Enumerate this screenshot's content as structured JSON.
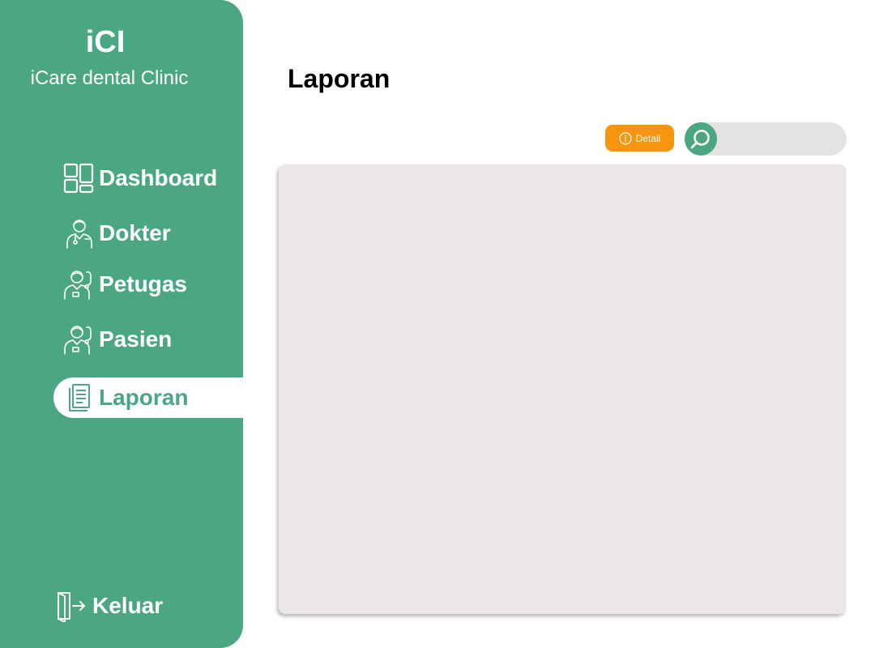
{
  "brand": {
    "logo": "iCI",
    "name": "iCare dental Clinic"
  },
  "sidebar": {
    "items": [
      {
        "label": "Dashboard",
        "icon": "dashboard-icon"
      },
      {
        "label": "Dokter",
        "icon": "doctor-icon"
      },
      {
        "label": "Petugas",
        "icon": "staff-icon"
      },
      {
        "label": "Pasien",
        "icon": "patient-icon"
      },
      {
        "label": "Laporan",
        "icon": "report-icon",
        "active": true
      }
    ],
    "logout": {
      "label": "Keluar",
      "icon": "logout-icon"
    }
  },
  "main": {
    "title": "Laporan",
    "detail_button": {
      "label": "Detail",
      "icon": "info-icon"
    },
    "search": {
      "icon": "search-icon",
      "value": ""
    }
  },
  "colors": {
    "sidebar": "#4aa683",
    "accent": "#f7950f",
    "panel": "#ece6e6",
    "search": "#e3e3e3"
  }
}
